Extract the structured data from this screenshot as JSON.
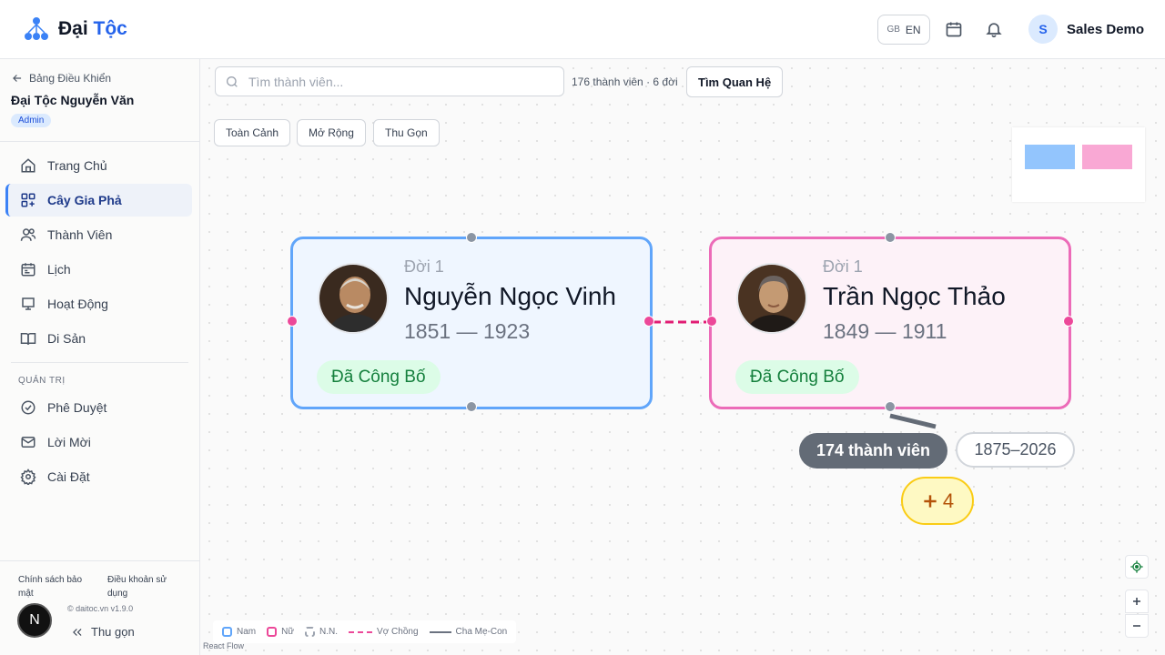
{
  "header": {
    "logo_text_part1": "Đại",
    "logo_text_part2": "Tộc",
    "lang_flag": "GB",
    "lang_code": "EN",
    "user_initial": "S",
    "user_name": "Sales Demo"
  },
  "sidebar": {
    "back_label": "Bảng Điều Khiển",
    "clan_name": "Đại Tộc Nguyễn Văn",
    "role": "Admin",
    "nav": [
      {
        "label": "Trang Chủ",
        "icon": "home-icon"
      },
      {
        "label": "Cây Gia Phả",
        "icon": "tree-icon",
        "active": true
      },
      {
        "label": "Thành Viên",
        "icon": "users-icon"
      },
      {
        "label": "Lịch",
        "icon": "calendar-icon"
      },
      {
        "label": "Hoạt Động",
        "icon": "activity-icon"
      },
      {
        "label": "Di Sản",
        "icon": "book-icon"
      }
    ],
    "admin_section_label": "QUẢN TRỊ",
    "admin_nav": [
      {
        "label": "Phê Duyệt",
        "icon": "check-circle-icon"
      },
      {
        "label": "Lời Mời",
        "icon": "mail-icon"
      },
      {
        "label": "Cài Đặt",
        "icon": "settings-icon"
      }
    ],
    "footer": {
      "privacy": "Chính sách bảo mật",
      "terms": "Điều khoản sử dụng",
      "version": "© daitoc.vn v1.9.0",
      "avatar_letter": "N",
      "collapse_label": "Thu gọn"
    }
  },
  "toolbar": {
    "search_placeholder": "Tìm thành viên...",
    "member_count": "176 thành viên · 6 đời",
    "find_relation": "Tìm Quan Hệ",
    "fit_view": "Toàn Cảnh",
    "expand": "Mở Rộng",
    "collapse": "Thu Gọn"
  },
  "nodes": [
    {
      "gen": "Đời 1",
      "name": "Nguyễn Ngọc Vinh",
      "years": "1851 — 1923",
      "status": "Đã Công Bố",
      "gender": "male"
    },
    {
      "gen": "Đời 1",
      "name": "Trần Ngọc Thảo",
      "years": "1849 — 1911",
      "status": "Đã Công Bố",
      "gender": "female"
    }
  ],
  "descendants": {
    "count_label": "174 thành viên",
    "range_label": "1875–2026",
    "more_label": "4"
  },
  "legend": {
    "male": "Nam",
    "female": "Nữ",
    "unknown": "N.N.",
    "spouse": "Vợ Chồng",
    "parent_child": "Cha Mẹ-Con"
  },
  "attribution": "React Flow",
  "colors": {
    "male_border": "#60a5fa",
    "female_border": "#ec6bb8",
    "spouse_line": "#e11d74",
    "status_green": "#15803d"
  }
}
